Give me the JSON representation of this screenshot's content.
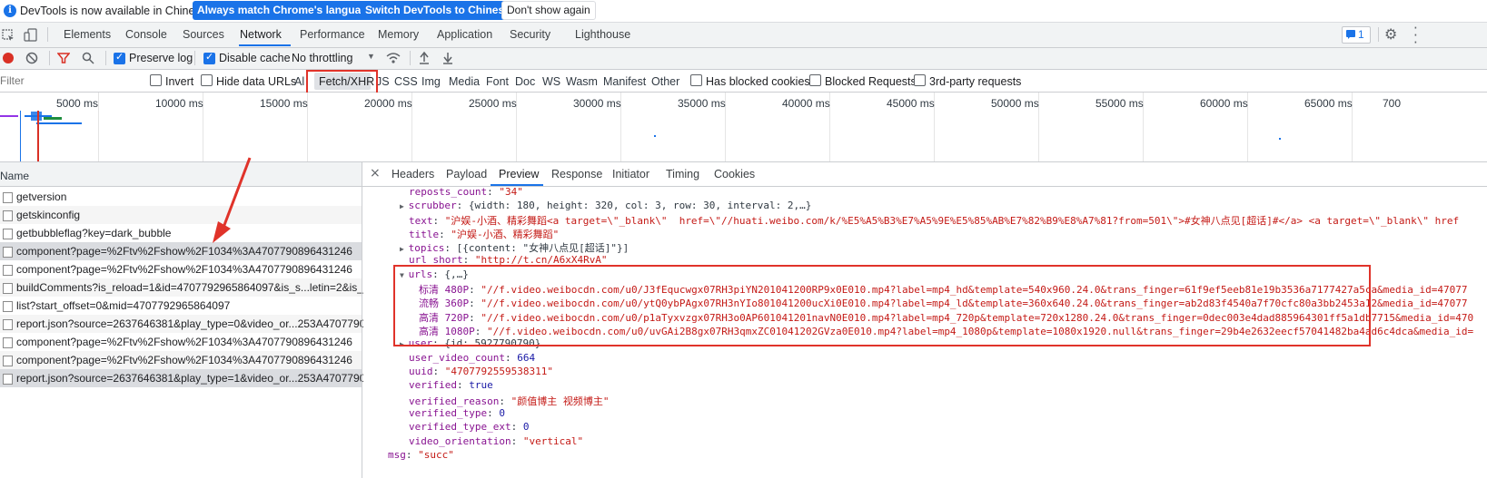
{
  "infobar": {
    "message": "DevTools is now available in Chinese!",
    "btn_match": "Always match Chrome's language",
    "btn_switch": "Switch DevTools to Chinese",
    "btn_dismiss": "Don't show again"
  },
  "main_tabs": [
    "Elements",
    "Console",
    "Sources",
    "Network",
    "Performance",
    "Memory",
    "Application",
    "Security",
    "Lighthouse"
  ],
  "issues_count": "1",
  "toolbar": {
    "preserve_log": "Preserve log",
    "disable_cache": "Disable cache",
    "throttling": "No throttling"
  },
  "filter": {
    "placeholder": "Filter",
    "invert": "Invert",
    "hide_data_urls": "Hide data URLs",
    "types": [
      "All",
      "Fetch/XHR",
      "JS",
      "CSS",
      "Img",
      "Media",
      "Font",
      "Doc",
      "WS",
      "Wasm",
      "Manifest",
      "Other"
    ],
    "has_blocked_cookies": "Has blocked cookies",
    "blocked_requests": "Blocked Requests",
    "third_party": "3rd-party requests"
  },
  "overview_ticks": [
    "5000 ms",
    "10000 ms",
    "15000 ms",
    "20000 ms",
    "25000 ms",
    "30000 ms",
    "35000 ms",
    "40000 ms",
    "45000 ms",
    "50000 ms",
    "55000 ms",
    "60000 ms",
    "65000 ms",
    "700"
  ],
  "requests": {
    "header": "Name",
    "items": [
      "getversion",
      "getskinconfig",
      "getbubbleflag?key=dark_bubble",
      "component?page=%2Ftv%2Fshow%2F1034%3A4707790896431246",
      "component?page=%2Ftv%2Fshow%2F1034%3A4707790896431246",
      "buildComments?is_reload=1&id=4707792965864097&is_s...letin=2&is_...",
      "list?start_offset=0&mid=4707792965864097",
      "report.json?source=2637646381&play_type=0&video_or...253A4707790...",
      "component?page=%2Ftv%2Fshow%2F1034%3A4707790896431246",
      "component?page=%2Ftv%2Fshow%2F1034%3A4707790896431246",
      "report.json?source=2637646381&play_type=1&video_or...253A4707790..."
    ]
  },
  "detail_tabs": [
    "Headers",
    "Payload",
    "Preview",
    "Response",
    "Initiator",
    "Timing",
    "Cookies"
  ],
  "preview": {
    "l1_key": "reposts_count",
    "l1_val": "\"34\"",
    "l2_key": "scrubber",
    "l2_val": "{width: 180, height: 320, col: 3, row: 30, interval: 2,…}",
    "l3_key": "text",
    "l3_val": "\"沪娱-小酒、精彩舞蹈<a target=\\\"_blank\\\"  href=\\\"//huati.weibo.com/k/%E5%A5%B3%E7%A5%9E%E5%85%AB%E7%82%B9%E8%A7%81?from=501\\\">#女神八点见[超话]#</a> <a target=\\\"_blank\\\" href",
    "l4_key": "title",
    "l4_val": "\"沪娱-小酒、精彩舞蹈\"",
    "l5_key": "topics",
    "l5_val": "[{content: \"女神八点见[超话]\"}]",
    "l6_key": "url_short",
    "l6_val": "\"http://t.cn/A6xX4RvA\"",
    "urls_key": "urls",
    "urls_val": "{,…}",
    "u1_key": "标清 480P",
    "u1_val": "\"//f.video.weibocdn.com/u0/J3fEqucwgx07RH3piYN201041200RP9x0E010.mp4?label=mp4_hd&template=540x960.24.0&trans_finger=61f9ef5eeb81e19b3536a7177427a5ca&media_id=47077",
    "u2_key": "流畅 360P",
    "u2_val": "\"//f.video.weibocdn.com/u0/ytQ0ybPAgx07RH3nYIo801041200ucXi0E010.mp4?label=mp4_ld&template=360x640.24.0&trans_finger=ab2d83f4540a7f70cfc80a3bb2453a12&media_id=47077",
    "u3_key": "高清 720P",
    "u3_val": "\"//f.video.weibocdn.com/u0/p1aTyxvzgx07RH3o0AP601041201navN0E010.mp4?label=mp4_720p&template=720x1280.24.0&trans_finger=0dec003e4dad885964301ff5a1db7715&media_id=470",
    "u4_key": "高清 1080P",
    "u4_val": "\"//f.video.weibocdn.com/u0/uvGAi2B8gx07RH3qmxZC01041202GVza0E010.mp4?label=mp4_1080p&template=1080x1920.null&trans_finger=29b4e2632eecf57041482ba4ad6c4dca&media_id=",
    "l7_key": "user",
    "l7_val": "{id: 5927790790}",
    "l8_key": "user_video_count",
    "l8_val": "664",
    "l9_key": "uuid",
    "l9_val": "\"4707792559538311\"",
    "l10_key": "verified",
    "l10_val": "true",
    "l11_key": "verified_reason",
    "l11_val": "\"颜值博主 视频博主\"",
    "l12_key": "verified_type",
    "l12_val": "0",
    "l13_key": "verified_type_ext",
    "l13_val": "0",
    "l14_key": "video_orientation",
    "l14_val": "\"vertical\"",
    "l15_key": "msg",
    "l15_val": "\"succ\""
  },
  "colors": {
    "accent": "#1a73e8",
    "highlight": "#e0332a"
  }
}
